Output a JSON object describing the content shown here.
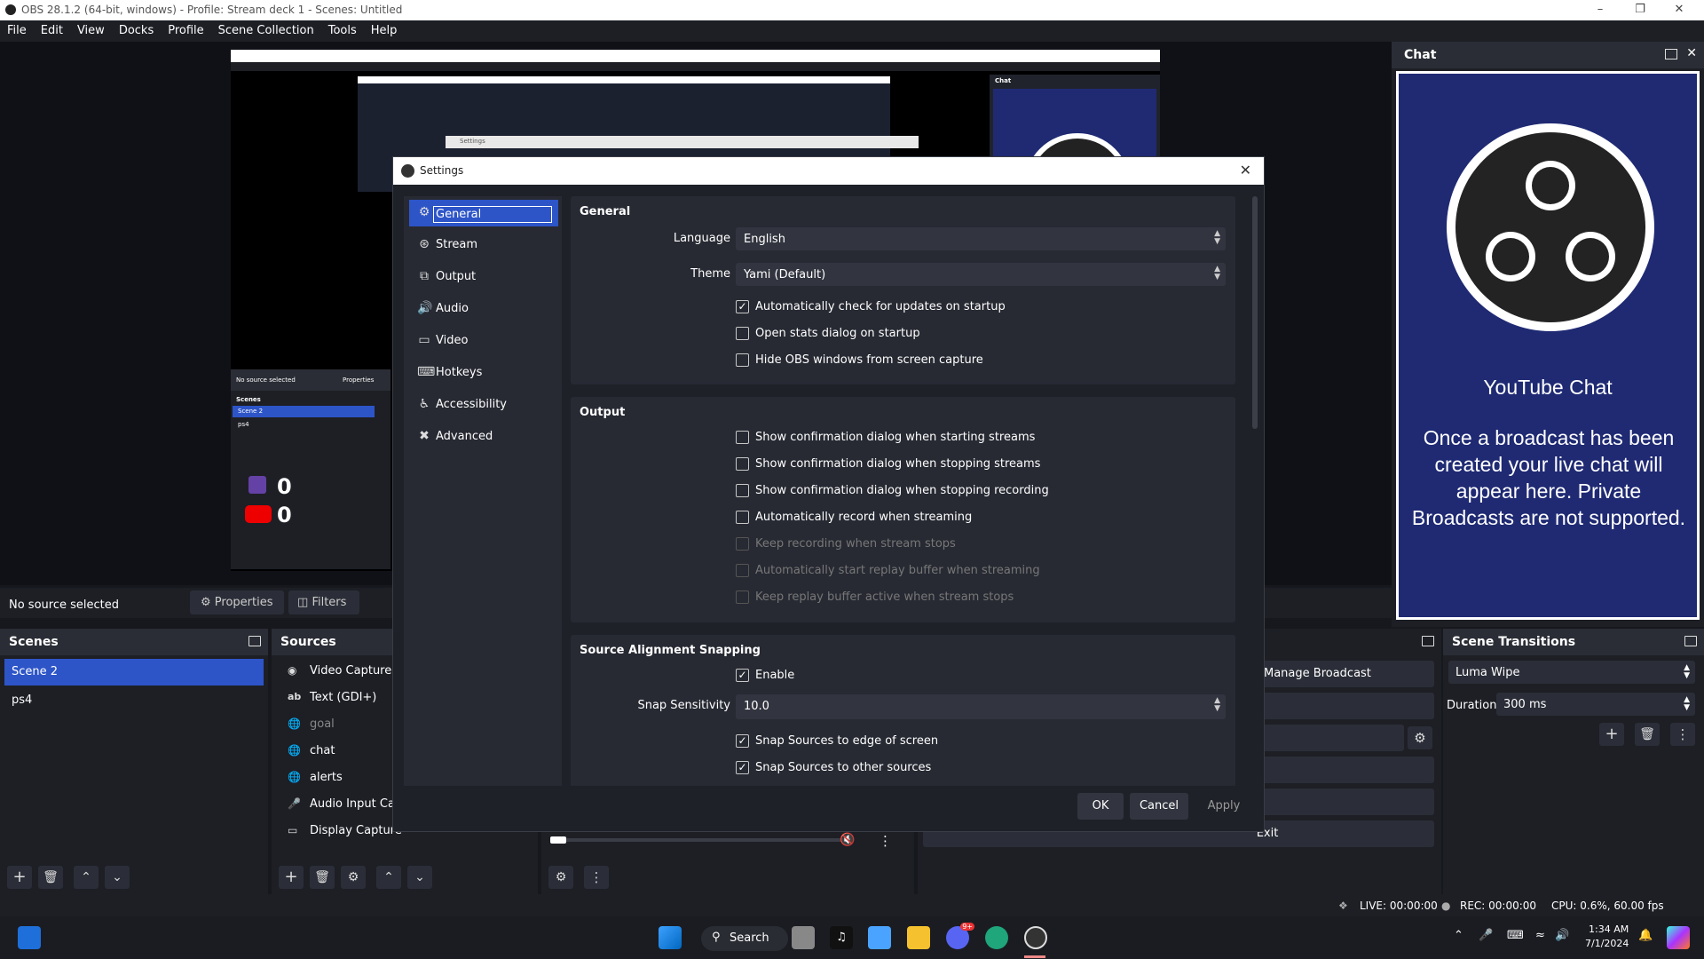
{
  "window": {
    "title": "OBS 28.1.2 (64-bit, windows) - Profile: Stream deck 1 - Scenes: Untitled"
  },
  "menu": [
    "File",
    "Edit",
    "View",
    "Docks",
    "Profile",
    "Scene Collection",
    "Tools",
    "Help"
  ],
  "chat": {
    "title": "Chat",
    "heading": "YouTube Chat",
    "message": "Once a broadcast has been created your live chat will appear here. Private Broadcasts are not supported."
  },
  "sourcebar": {
    "status": "No source selected",
    "properties": "Properties",
    "filters": "Filters"
  },
  "scenes": {
    "title": "Scenes",
    "items": [
      "Scene 2",
      "ps4"
    ]
  },
  "sources": {
    "title": "Sources",
    "items": [
      "Video Capture De",
      "Text (GDI+)",
      "goal",
      "chat",
      "alerts",
      "Audio Input Capt",
      "Display Capture"
    ]
  },
  "controls": {
    "manage_broadcast": "Manage Broadcast",
    "exit": "Exit"
  },
  "transitions": {
    "title": "Scene Transitions",
    "selected": "Luma Wipe",
    "duration_label": "Duration",
    "duration_value": "300 ms"
  },
  "status": {
    "live": "LIVE: 00:00:00",
    "rec": "REC: 00:00:00",
    "cpu": "CPU: 0.6%, 60.00 fps"
  },
  "taskbar": {
    "search": "Search",
    "time": "1:34 AM",
    "date": "7/1/2024",
    "discord_badge": "9+"
  },
  "settings": {
    "title": "Settings",
    "nav": [
      "General",
      "Stream",
      "Output",
      "Audio",
      "Video",
      "Hotkeys",
      "Accessibility",
      "Advanced"
    ],
    "general": {
      "title": "General",
      "language_label": "Language",
      "language_value": "English",
      "theme_label": "Theme",
      "theme_value": "Yami (Default)",
      "checks": [
        "Automatically check for updates on startup",
        "Open stats dialog on startup",
        "Hide OBS windows from screen capture"
      ],
      "checked": [
        true,
        false,
        false
      ]
    },
    "output": {
      "title": "Output",
      "checks": [
        "Show confirmation dialog when starting streams",
        "Show confirmation dialog when stopping streams",
        "Show confirmation dialog when stopping recording",
        "Automatically record when streaming",
        "Keep recording when stream stops",
        "Automatically start replay buffer when streaming",
        "Keep replay buffer active when stream stops"
      ]
    },
    "snapping": {
      "title": "Source Alignment Snapping",
      "enable": "Enable",
      "sensitivity_label": "Snap Sensitivity",
      "sensitivity_value": "10.0",
      "checks": [
        "Snap Sources to edge of screen",
        "Snap Sources to other sources"
      ]
    },
    "buttons": {
      "ok": "OK",
      "cancel": "Cancel",
      "apply": "Apply"
    }
  },
  "nested_preview": {
    "no_source": "No source selected",
    "properties": "Properties",
    "scenes": "Scenes",
    "scene_items": [
      "Scene 2",
      "ps4"
    ],
    "twitch_count": "0",
    "youtube_count": "0",
    "settings_title": "Settings",
    "chat_title": "Chat"
  }
}
